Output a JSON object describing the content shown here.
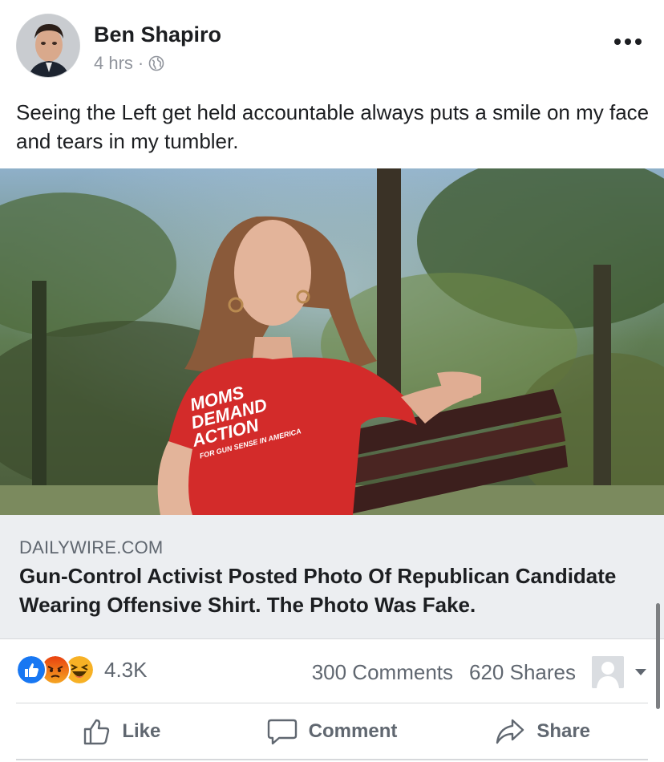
{
  "post": {
    "author": "Ben Shapiro",
    "time": "4 hrs",
    "separator": "·",
    "privacy_icon": "globe-icon",
    "text": "Seeing the Left get held accountable always puts a smile on my face and tears in my tumbler.",
    "more_icon": "more-options-icon"
  },
  "photo": {
    "shirt_text": [
      "MOMS",
      "DEMAND",
      "ACTION",
      "FOR GUN SENSE IN AMERICA"
    ]
  },
  "link": {
    "domain": "DAILYWIRE.COM",
    "headline": "Gun-Control Activist Posted Photo Of Republican Candidate Wearing Offensive Shirt. The Photo Was Fake."
  },
  "engagement": {
    "reaction_icons": [
      "like-reaction-icon",
      "angry-reaction-icon",
      "haha-reaction-icon"
    ],
    "reaction_count": "4.3K",
    "comments": "300 Comments",
    "shares": "620 Shares"
  },
  "actions": {
    "like": "Like",
    "comment": "Comment",
    "share": "Share"
  },
  "colors": {
    "like_blue": "#1877f2",
    "angry_orange": "#e9710f",
    "haha_yellow": "#f7b125",
    "link_box_bg": "#eceef1",
    "shirt_red": "#d32b2a"
  }
}
